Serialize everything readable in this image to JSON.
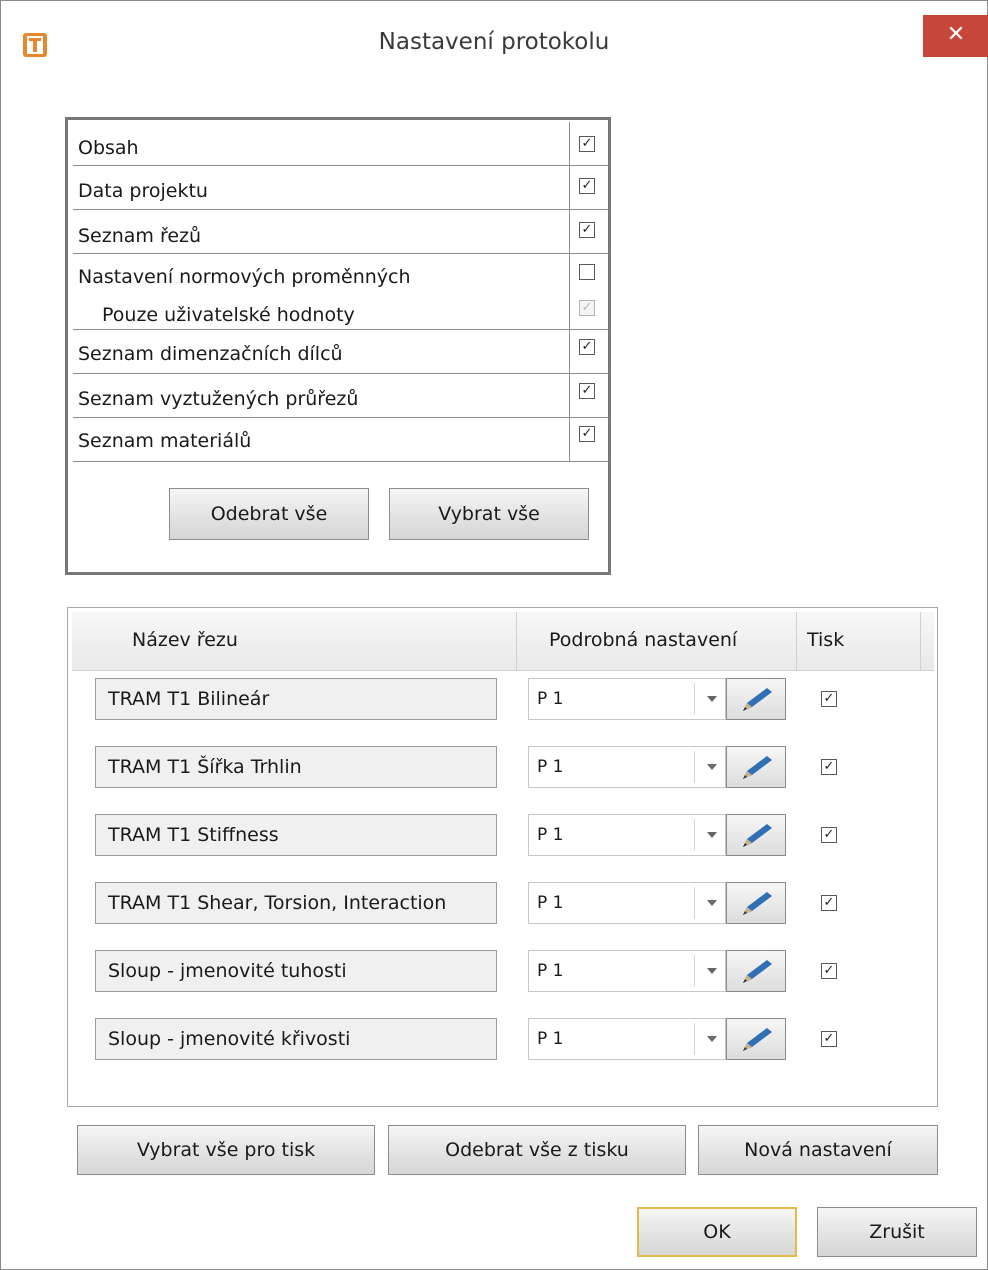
{
  "window": {
    "title": "Nastavení protokolu",
    "close_glyph": "✕"
  },
  "sections": {
    "items": [
      {
        "label": "Obsah",
        "checked": true
      },
      {
        "label": "Data projektu",
        "checked": true
      },
      {
        "label": "Seznam řezů",
        "checked": true
      },
      {
        "label": "Nastavení normových proměnných",
        "checked": false
      },
      {
        "label": "Pouze uživatelské hodnoty",
        "checked": true,
        "disabled": true
      },
      {
        "label": "Seznam dimenzačních dílců",
        "checked": true
      },
      {
        "label": "Seznam vyztužených průřezů",
        "checked": true
      },
      {
        "label": "Seznam materiálů",
        "checked": true
      }
    ],
    "remove_all_label": "Odebrat vše",
    "select_all_label": "Vybrat vše"
  },
  "table": {
    "headers": {
      "name": "Název řezu",
      "detail": "Podrobná nastavení",
      "print": "Tisk"
    },
    "rows": [
      {
        "name": "TRAM T1 Bilineár",
        "setting": "P 1",
        "print": true
      },
      {
        "name": "TRAM T1  Šířka Trhlin",
        "setting": "P 1",
        "print": true
      },
      {
        "name": "TRAM T1  Stiffness",
        "setting": "P 1",
        "print": true
      },
      {
        "name": "TRAM T1 Shear, Torsion, Interaction",
        "setting": "P 1",
        "print": true
      },
      {
        "name": "Sloup - jmenovité tuhosti",
        "setting": "P 1",
        "print": true
      },
      {
        "name": "Sloup - jmenovité křivosti",
        "setting": "P 1",
        "print": true
      }
    ]
  },
  "bottom": {
    "select_all_print": "Vybrat vše pro tisk",
    "remove_all_print": "Odebrat vše z tisku",
    "new_settings": "Nová nastavení"
  },
  "dialog": {
    "ok": "OK",
    "cancel": "Zrušit"
  },
  "colors": {
    "accent_close": "#c7463a",
    "app_icon": "#e8862b",
    "ok_border": "#e8b84a"
  }
}
